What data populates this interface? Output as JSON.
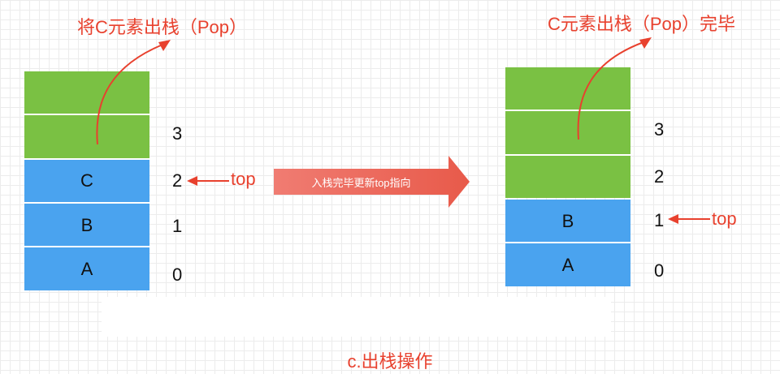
{
  "titles": {
    "left": "将C元素出栈（Pop）",
    "right": "C元素出栈（Pop）完毕"
  },
  "left_stack": {
    "cells": [
      "",
      "",
      "C",
      "B",
      "A"
    ],
    "indices": [
      "3",
      "2",
      "1",
      "0"
    ],
    "top_label": "top"
  },
  "right_stack": {
    "cells": [
      "",
      "",
      "",
      "B",
      "A"
    ],
    "indices": [
      "3",
      "2",
      "1",
      "0"
    ],
    "top_label": "top"
  },
  "middle_arrow": {
    "label": "入栈完毕更新top指向"
  },
  "caption": "c.出栈操作",
  "colors": {
    "green": "#7ac143",
    "blue": "#4aa3ef",
    "red": "#e8412e"
  }
}
